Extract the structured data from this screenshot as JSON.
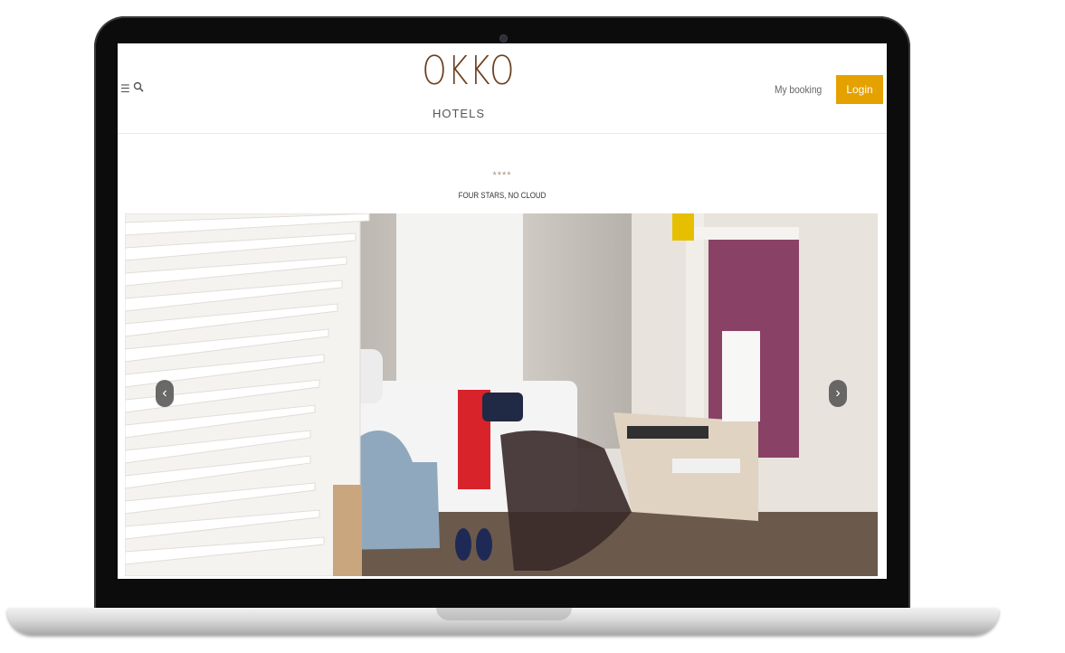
{
  "header": {
    "logo_main": "OKKO",
    "logo_sub": "HOTELS",
    "menu_icon": "menu-icon",
    "search_icon": "search-icon",
    "my_booking": "My booking",
    "login": "Login",
    "login_color": "#e5a100"
  },
  "intro": {
    "stars": "****",
    "tagline": "FOUR STARS, NO CLOUD"
  },
  "hero": {
    "prev_label": "‹",
    "next_label": "›",
    "image": "hotel-room-photo"
  }
}
